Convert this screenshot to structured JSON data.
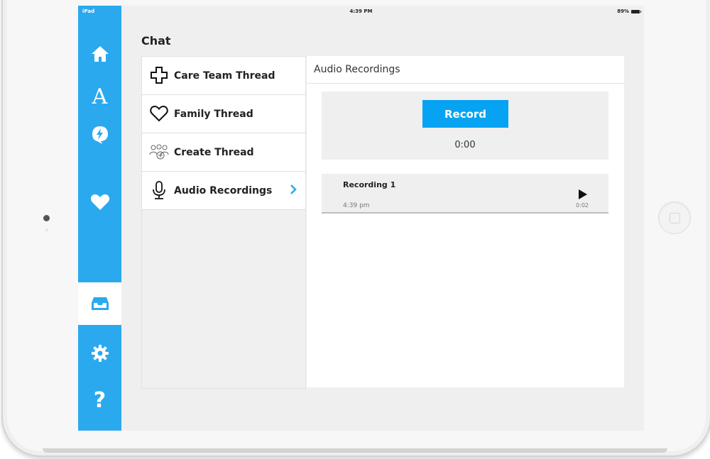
{
  "status_bar": {
    "device": "iPad",
    "time": "4:39 PM",
    "battery": "89%"
  },
  "nav": {
    "items": [
      {
        "name": "home",
        "icon": "home-icon"
      },
      {
        "name": "alphabet",
        "icon": "letter-a-icon",
        "label": "A"
      },
      {
        "name": "alerts",
        "icon": "lightning-speech-bubble-icon"
      },
      {
        "name": "favorites",
        "icon": "heart-icon"
      },
      {
        "name": "inbox",
        "icon": "inbox-tray-icon",
        "active": true
      },
      {
        "name": "settings",
        "icon": "gear-icon"
      },
      {
        "name": "help",
        "icon": "question-mark-icon",
        "label": "?"
      }
    ],
    "accent_color": "#2aa9ef"
  },
  "page": {
    "title": "Chat"
  },
  "threads": [
    {
      "label": "Care Team Thread",
      "icon": "medical-cross-icon"
    },
    {
      "label": "Family Thread",
      "icon": "heart-outline-icon"
    },
    {
      "label": "Create Thread",
      "icon": "add-group-icon"
    },
    {
      "label": "Audio Recordings",
      "icon": "microphone-icon",
      "selected": true
    }
  ],
  "detail": {
    "title": "Audio Recordings",
    "record_label": "Record",
    "timer": "0:00",
    "recordings": [
      {
        "name": "Recording 1",
        "time": "4:39 pm",
        "duration": "0:02"
      }
    ],
    "record_color": "#06a3f2"
  }
}
